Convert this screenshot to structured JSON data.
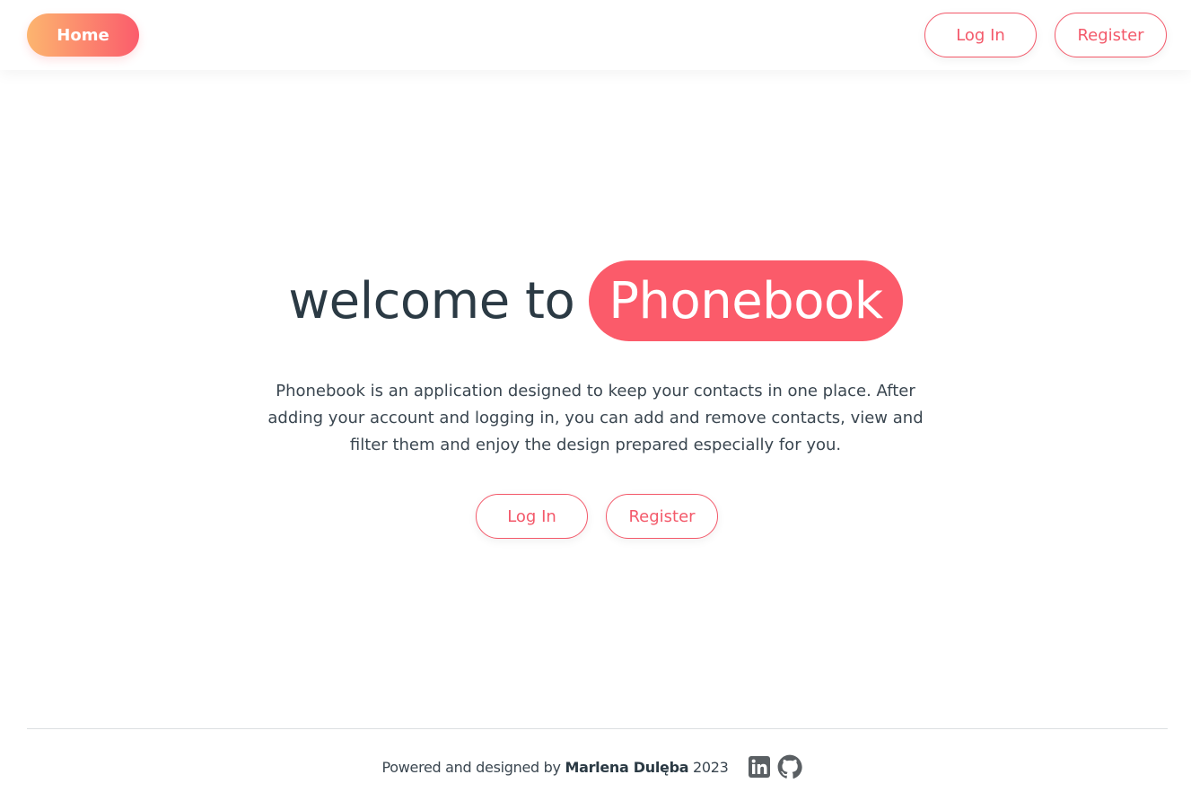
{
  "header": {
    "home_label": "Home",
    "login_label": "Log In",
    "register_label": "Register"
  },
  "hero": {
    "welcome_text": "welcome to",
    "brand_text": "Phonebook",
    "description": "Phonebook is an application designed to keep your contacts in one place. After adding your account and logging in, you can add and remove contacts, view and filter them and enjoy the design prepared especially for you.",
    "login_label": "Log In",
    "register_label": "Register"
  },
  "footer": {
    "prefix": "Powered and designed by ",
    "author": "Marlena Dulęba",
    "year": " 2023",
    "icons": [
      "linkedin-icon",
      "github-icon"
    ]
  },
  "colors": {
    "accent": "#fb5b6a",
    "gradient_start": "#fcb56f",
    "text_dark": "#2b3a44"
  }
}
